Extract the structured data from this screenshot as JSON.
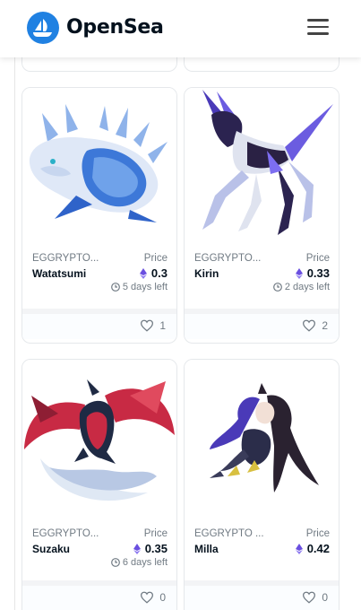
{
  "header": {
    "brand": "OpenSea",
    "logo_icon": "opensea-logo-icon",
    "menu_icon": "hamburger-menu-icon",
    "brand_color": "#2081e2"
  },
  "partial_row": [
    {
      "likes": "1"
    },
    {
      "likes": "2"
    }
  ],
  "cards": [
    {
      "collection": "EGGRYPTO...",
      "price_label": "Price",
      "name": "Watatsumi",
      "price": "0.3",
      "time_left": "5 days left",
      "likes": "1"
    },
    {
      "collection": "EGGRYPTO...",
      "price_label": "Price",
      "name": "Kirin",
      "price": "0.33",
      "time_left": "2 days left",
      "likes": "2"
    },
    {
      "collection": "EGGRYPTO...",
      "price_label": "Price",
      "name": "Suzaku",
      "price": "0.35",
      "time_left": "6 days left",
      "likes": "0"
    },
    {
      "collection": "EGGRYPTO ...",
      "price_label": "Price",
      "name": "Milla",
      "price": "0.42",
      "time_left": "",
      "likes": "0"
    }
  ],
  "colors": {
    "eth": "#6a4fe0",
    "muted": "#707a83",
    "text": "#04111d"
  }
}
